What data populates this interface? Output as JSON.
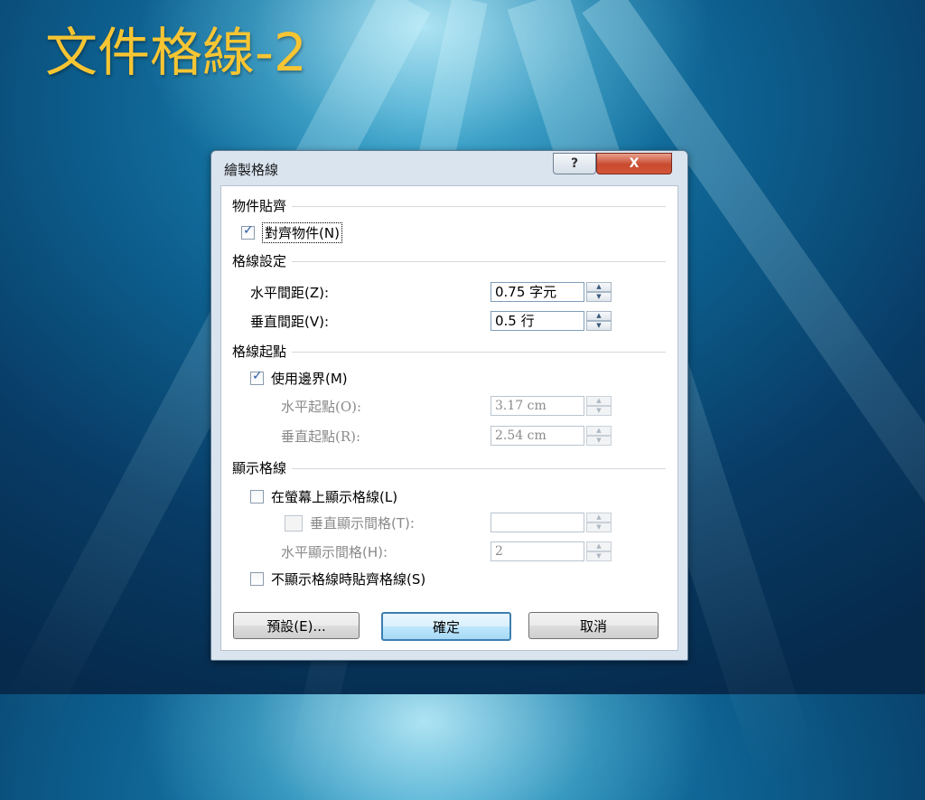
{
  "slide": {
    "title": "文件格線-2"
  },
  "dialog": {
    "title": "繪製格線",
    "help_glyph": "?",
    "close_glyph": "X",
    "snap_group": {
      "label": "物件貼齊",
      "snap_to_objects": {
        "label": "對齊物件(N)",
        "checked": true
      }
    },
    "grid_settings": {
      "label": "格線設定",
      "horizontal_spacing": {
        "label": "水平間距(Z):",
        "value": "0.75 字元"
      },
      "vertical_spacing": {
        "label": "垂直間距(V):",
        "value": "0.5 行"
      }
    },
    "grid_origin": {
      "label": "格線起點",
      "use_margins": {
        "label": "使用邊界(M)",
        "checked": true
      },
      "horizontal_origin": {
        "label": "水平起點(O):",
        "value": "3.17 cm"
      },
      "vertical_origin": {
        "label": "垂直起點(R):",
        "value": "2.54 cm"
      }
    },
    "show_grid": {
      "label": "顯示格線",
      "display_on_screen": {
        "label": "在螢幕上顯示格線(L)",
        "checked": false
      },
      "vertical_every": {
        "label": "垂直顯示間格(T):",
        "checked": false,
        "value": ""
      },
      "horizontal_every": {
        "label": "水平顯示間格(H):",
        "value": "2"
      },
      "snap_when_hidden": {
        "label": "不顯示格線時貼齊格線(S)",
        "checked": false
      }
    },
    "buttons": {
      "default": "預設(E)...",
      "ok": "確定",
      "cancel": "取消"
    }
  },
  "colors": {
    "title": "#f7c533",
    "background_dark": "#062a4c",
    "background_light": "#1f8fbd"
  }
}
